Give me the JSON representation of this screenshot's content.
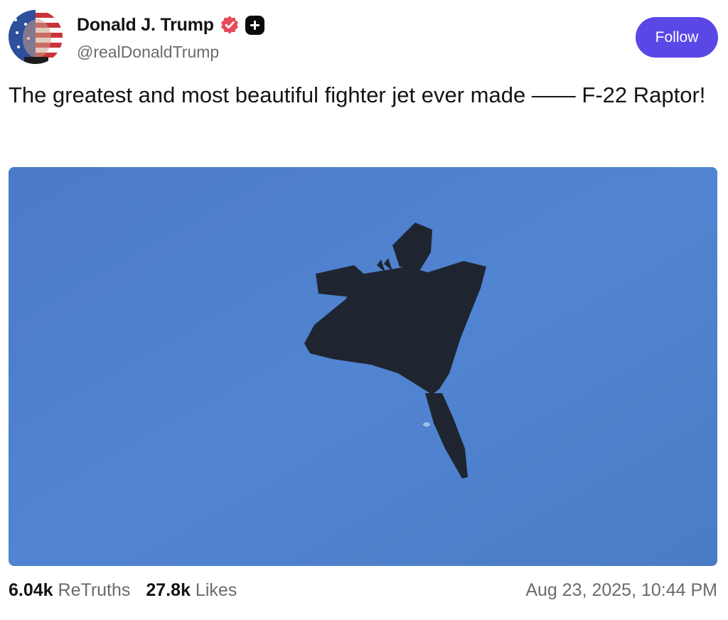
{
  "author": {
    "display_name": "Donald J. Trump",
    "handle": "@realDonaldTrump",
    "verified_icon": "verified-badge-icon",
    "plus_icon": "plus-badge-icon",
    "verified_color": "#e5495b"
  },
  "actions": {
    "follow_label": "Follow",
    "follow_color": "#5a48e6"
  },
  "post": {
    "text": "The greatest and most beautiful fighter jet ever made —— F-22 Raptor!",
    "media": {
      "subject": "fighter-jet-in-sky",
      "sky_color": "#4f80cc"
    }
  },
  "stats": {
    "retruths_count": "6.04k",
    "retruths_label": "ReTruths",
    "likes_count": "27.8k",
    "likes_label": "Likes"
  },
  "timestamp": "Aug 23, 2025, 10:44 PM"
}
